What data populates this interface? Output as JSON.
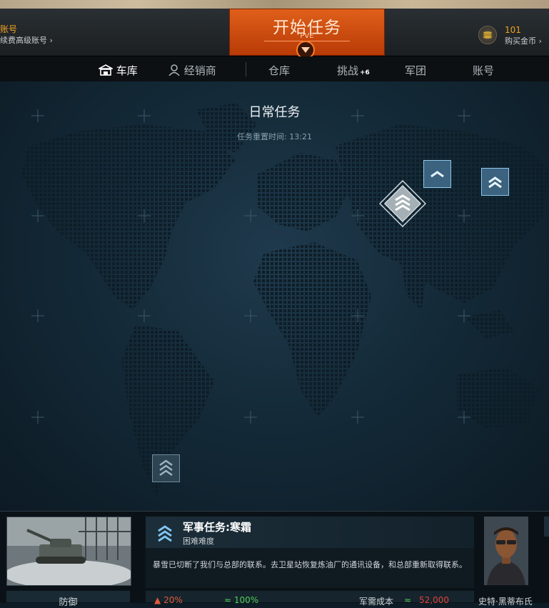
{
  "account": {
    "title": "账号",
    "subtitle": "续费高级账号"
  },
  "start": {
    "label": "开始任务",
    "mode": "PVE"
  },
  "gold": {
    "count": "101",
    "buy_label": "购买金币"
  },
  "nav": {
    "garage": "车库",
    "dealer": "经销商",
    "depot": "仓库",
    "challenges": "挑战",
    "challenges_badge": "+6",
    "legion": "军团",
    "account": "账号"
  },
  "map": {
    "title": "日常任务",
    "reset_time": "任务重置时间: 13:21"
  },
  "mission": {
    "title": "军事任务:寒霜",
    "difficulty": "困难难度",
    "description": "暴雪已切断了我们与总部的联系。去卫星站恢复炼油厂的通讯设备，和总部重新取得联系。",
    "type": "防御",
    "stat_1": "20%",
    "stat_2": "100%",
    "cost_label": "军需成本",
    "cost_value": "52,000",
    "commander": "史特·黑蒂布氏"
  },
  "colors": {
    "accent_orange": "#d9561a",
    "gold_text": "#f0a020",
    "marker_blue": "#5fb8e8",
    "cost_red": "#e0433a",
    "stat_green": "#4fcf5a"
  }
}
